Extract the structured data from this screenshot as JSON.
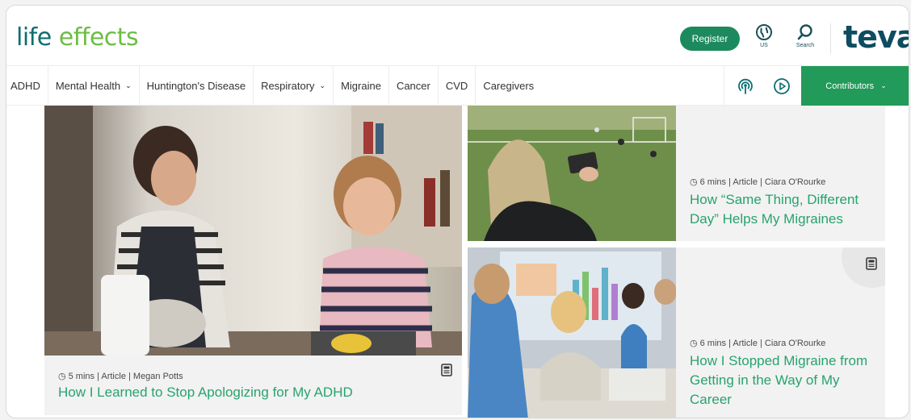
{
  "header": {
    "logo_part1": "life",
    "logo_part2": "effects",
    "register_label": "Register",
    "region_label": "US",
    "search_label": "Search",
    "brand": "teva"
  },
  "nav": {
    "items": [
      {
        "label": "ADHD",
        "has_dropdown": false
      },
      {
        "label": "Mental Health",
        "has_dropdown": true
      },
      {
        "label": "Huntington's Disease",
        "has_dropdown": false
      },
      {
        "label": "Respiratory",
        "has_dropdown": true
      },
      {
        "label": "Migraine",
        "has_dropdown": false
      },
      {
        "label": "Cancer",
        "has_dropdown": false
      },
      {
        "label": "CVD",
        "has_dropdown": false
      },
      {
        "label": "Caregivers",
        "has_dropdown": false
      }
    ],
    "contributors_label": "Contributors",
    "chevron": "⌄",
    "icons": [
      "podcast-icon",
      "play-icon"
    ]
  },
  "articles": {
    "hero": {
      "meta": "5 mins | Article | Megan Potts",
      "title": "How I Learned to Stop Apologizing for My ADHD"
    },
    "card1": {
      "meta": "6 mins | Article | Ciara O'Rourke",
      "title": "How “Same Thing, Different Day” Helps My Migraines"
    },
    "card2": {
      "meta": "6 mins | Article | Ciara O'Rourke",
      "title": "How I Stopped Migraine from Getting in the Way of My Career"
    }
  },
  "colors": {
    "accent_green": "#27a36e",
    "register_bg": "#1d8a5d",
    "contributors_bg": "#219a5a",
    "teva_navy": "#0d4c61"
  }
}
